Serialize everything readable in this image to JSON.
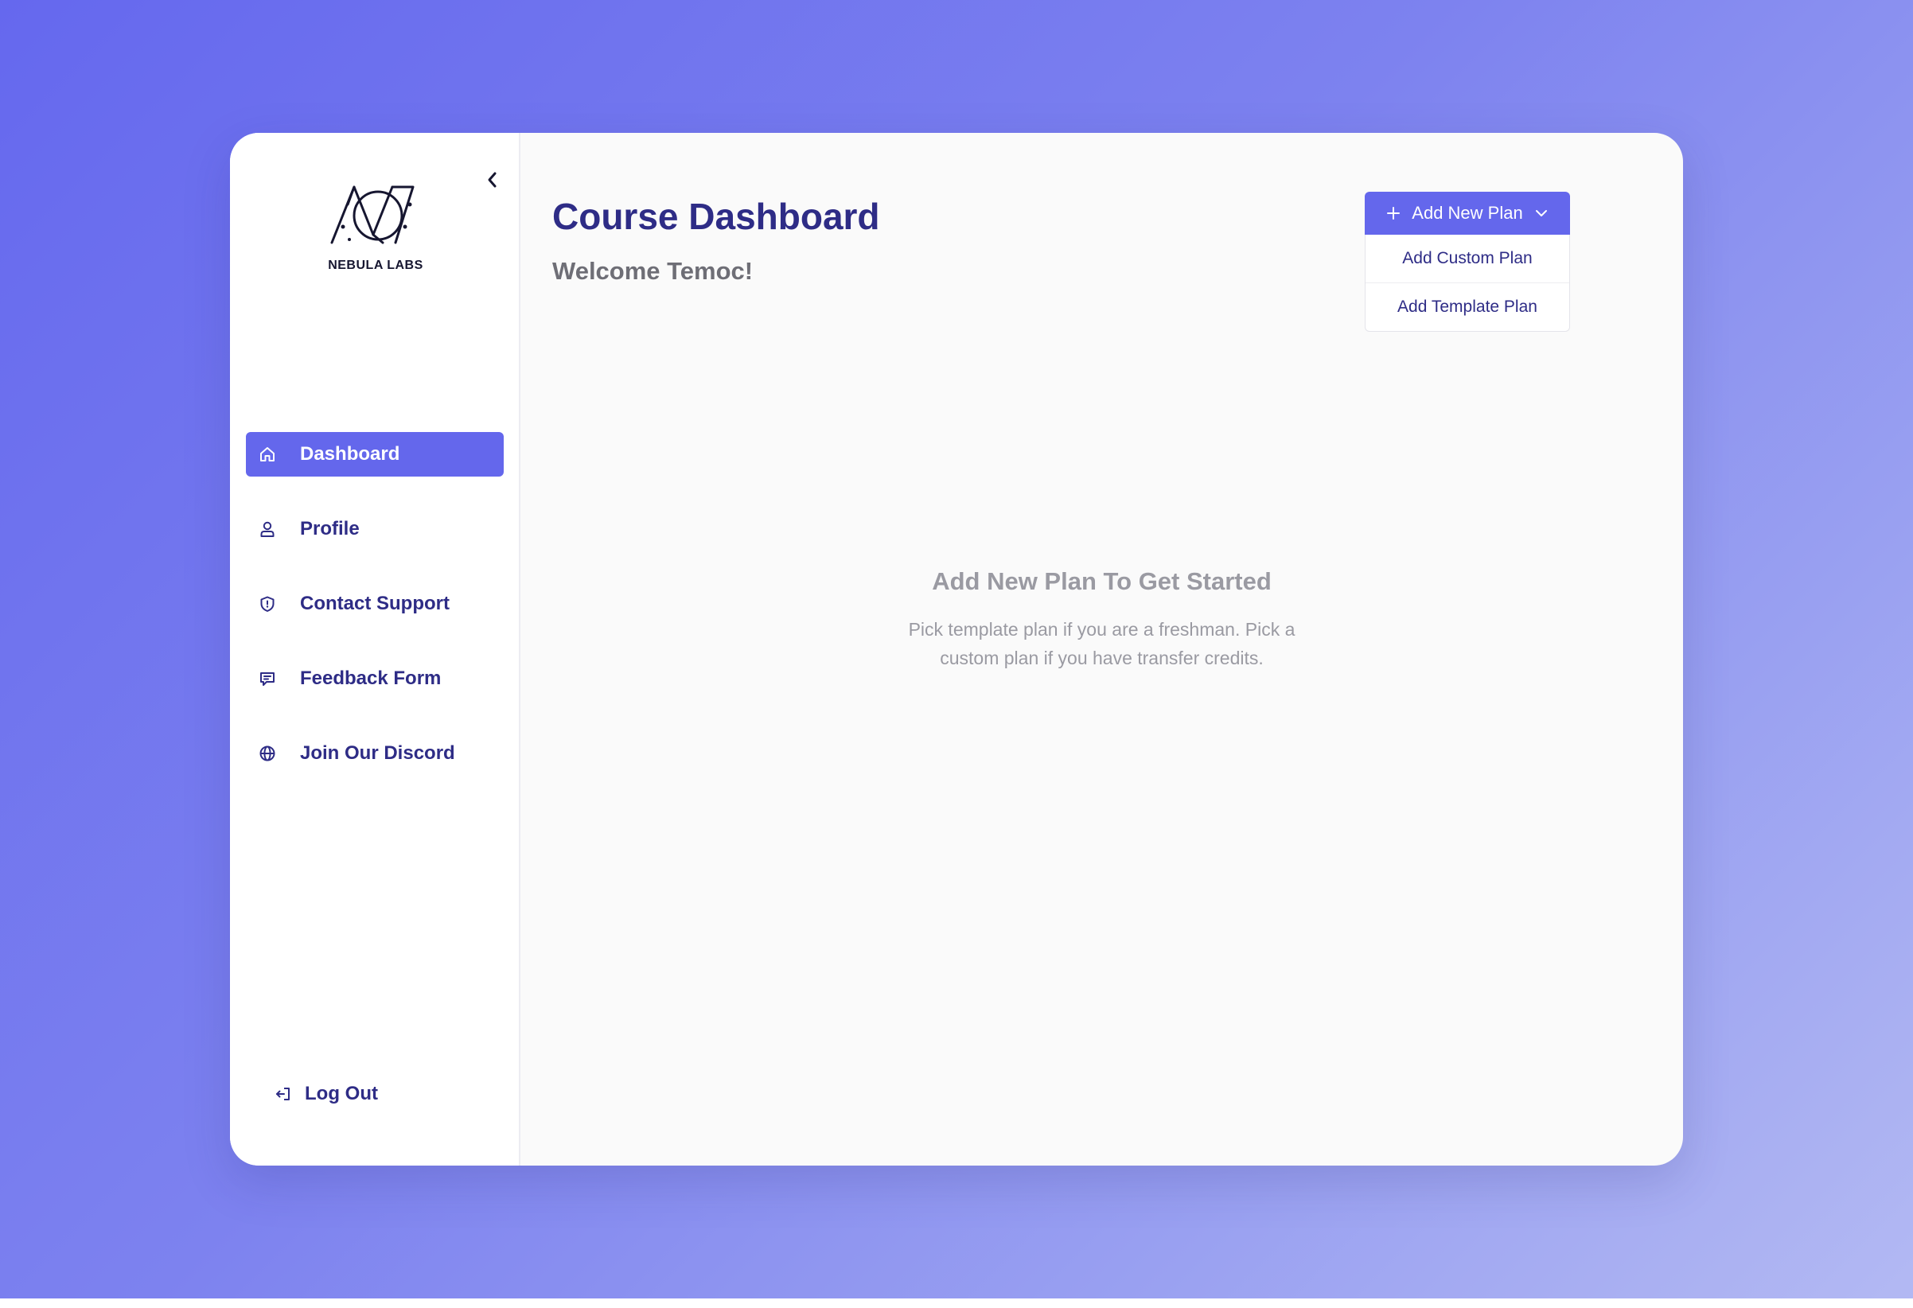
{
  "sidebar": {
    "logo_text": "NEBULA LABS",
    "nav_items": [
      {
        "label": "Dashboard",
        "icon": "home-icon",
        "active": true
      },
      {
        "label": "Profile",
        "icon": "user-icon",
        "active": false
      },
      {
        "label": "Contact Support",
        "icon": "shield-icon",
        "active": false
      },
      {
        "label": "Feedback Form",
        "icon": "message-icon",
        "active": false
      },
      {
        "label": "Join Our Discord",
        "icon": "globe-icon",
        "active": false
      }
    ],
    "logout_label": "Log Out"
  },
  "main": {
    "title": "Course Dashboard",
    "welcome": "Welcome Temoc!",
    "add_plan_button": "Add New Plan",
    "dropdown_items": [
      "Add Custom Plan",
      "Add Template Plan"
    ],
    "empty_state": {
      "title": "Add New Plan To Get Started",
      "description": "Pick template plan if you are a freshman. Pick a custom plan if you have transfer credits."
    }
  },
  "colors": {
    "accent": "#6467ec",
    "text_primary": "#2e2c86",
    "muted": "#9a9aa2",
    "background_gradient_start": "#6568ee",
    "background_gradient_end": "#b3b9f3"
  }
}
